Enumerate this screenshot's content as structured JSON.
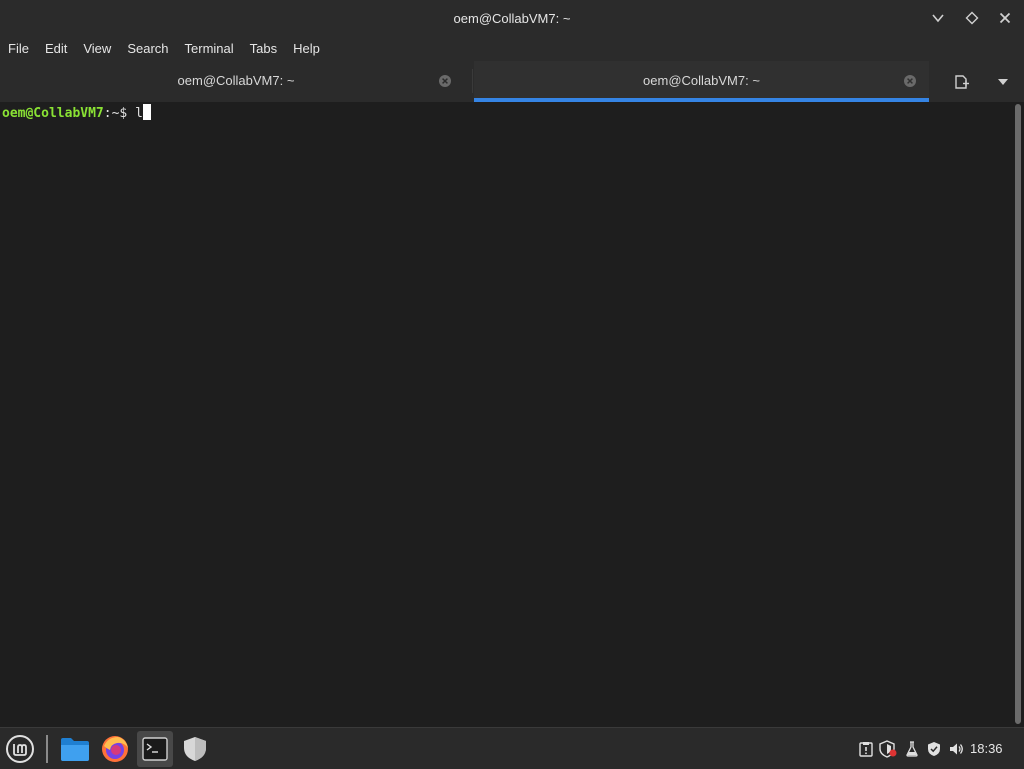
{
  "window": {
    "title": "oem@CollabVM7: ~"
  },
  "menu": {
    "items": [
      "File",
      "Edit",
      "View",
      "Search",
      "Terminal",
      "Tabs",
      "Help"
    ]
  },
  "tabs": [
    {
      "label": "oem@CollabVM7: ~",
      "active": false
    },
    {
      "label": "oem@CollabVM7: ~",
      "active": true
    }
  ],
  "terminal": {
    "prompt_user": "oem@CollabVM7",
    "prompt_sep": ":",
    "prompt_dir": "~$ ",
    "input": "l"
  },
  "taskbar": {
    "apps": [
      "menu-icon",
      "files-icon",
      "firefox-icon",
      "terminal-icon",
      "shield-icon"
    ],
    "tray": [
      "clipboard-icon",
      "update-shield-icon",
      "flask-icon",
      "security-icon",
      "volume-icon"
    ],
    "clock": "18:36"
  },
  "colors": {
    "prompt_user": "#8ae234",
    "active_tab_accent": "#3584e4",
    "background": "#1e1e1e"
  }
}
